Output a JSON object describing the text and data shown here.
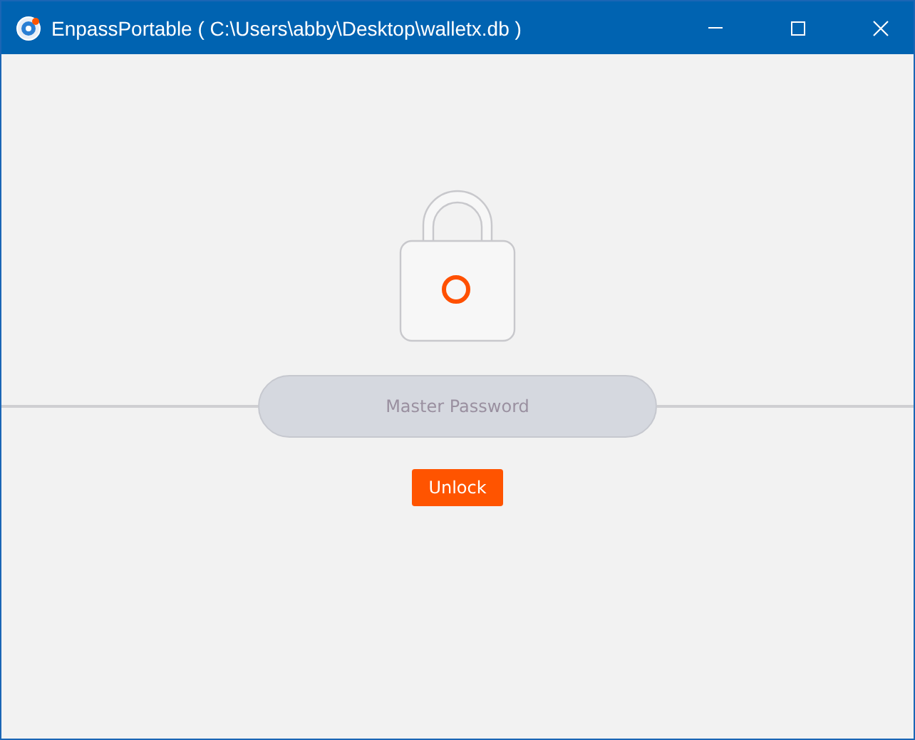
{
  "window": {
    "title": "EnpassPortable ( C:\\Users\\abby\\Desktop\\walletx.db )"
  },
  "password_field": {
    "placeholder": "Master Password"
  },
  "unlock_button": {
    "label": "Unlock"
  }
}
